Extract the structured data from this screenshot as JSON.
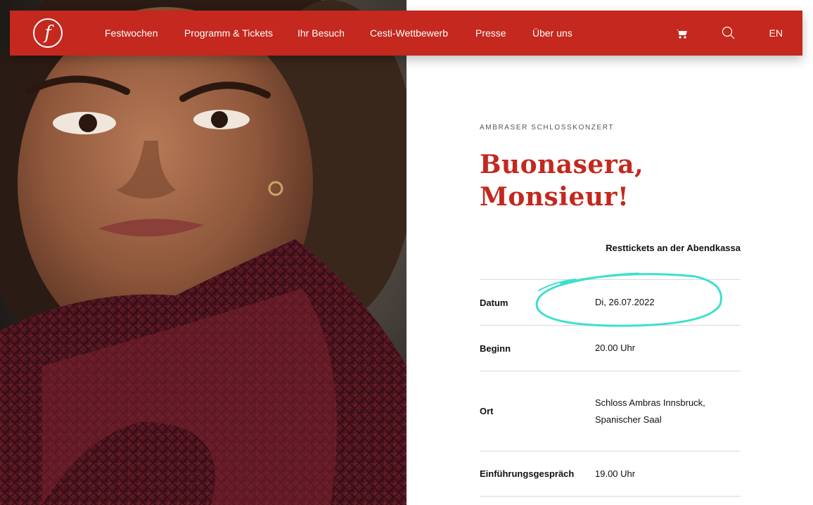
{
  "header": {
    "nav": [
      {
        "label": "Festwochen"
      },
      {
        "label": "Programm & Tickets"
      },
      {
        "label": "Ihr Besuch"
      },
      {
        "label": "Cesti-Wettbewerb"
      },
      {
        "label": "Presse"
      },
      {
        "label": "Über uns"
      }
    ],
    "logo_letter": "f",
    "cart_icon": "cart-icon",
    "search_icon": "search-icon",
    "language": "EN"
  },
  "event": {
    "category": "AMBRASER SCHLOSSKONZERT",
    "title_line1": "Buonasera,",
    "title_line2": "Monsieur!",
    "availability": "Resttickets an der Abendkassa",
    "details": [
      {
        "label": "Datum",
        "value": "Di, 26.07.2022"
      },
      {
        "label": "Beginn",
        "value": "20.00 Uhr"
      },
      {
        "label": "Ort",
        "value_line1": "Schloss Ambras Innsbruck,",
        "value_line2": "Spanischer Saal"
      },
      {
        "label": "Einführungsgespräch",
        "value": "19.00 Uhr"
      }
    ]
  },
  "colors": {
    "brand_red": "#c4281e",
    "highlight": "#3ee0cc"
  }
}
